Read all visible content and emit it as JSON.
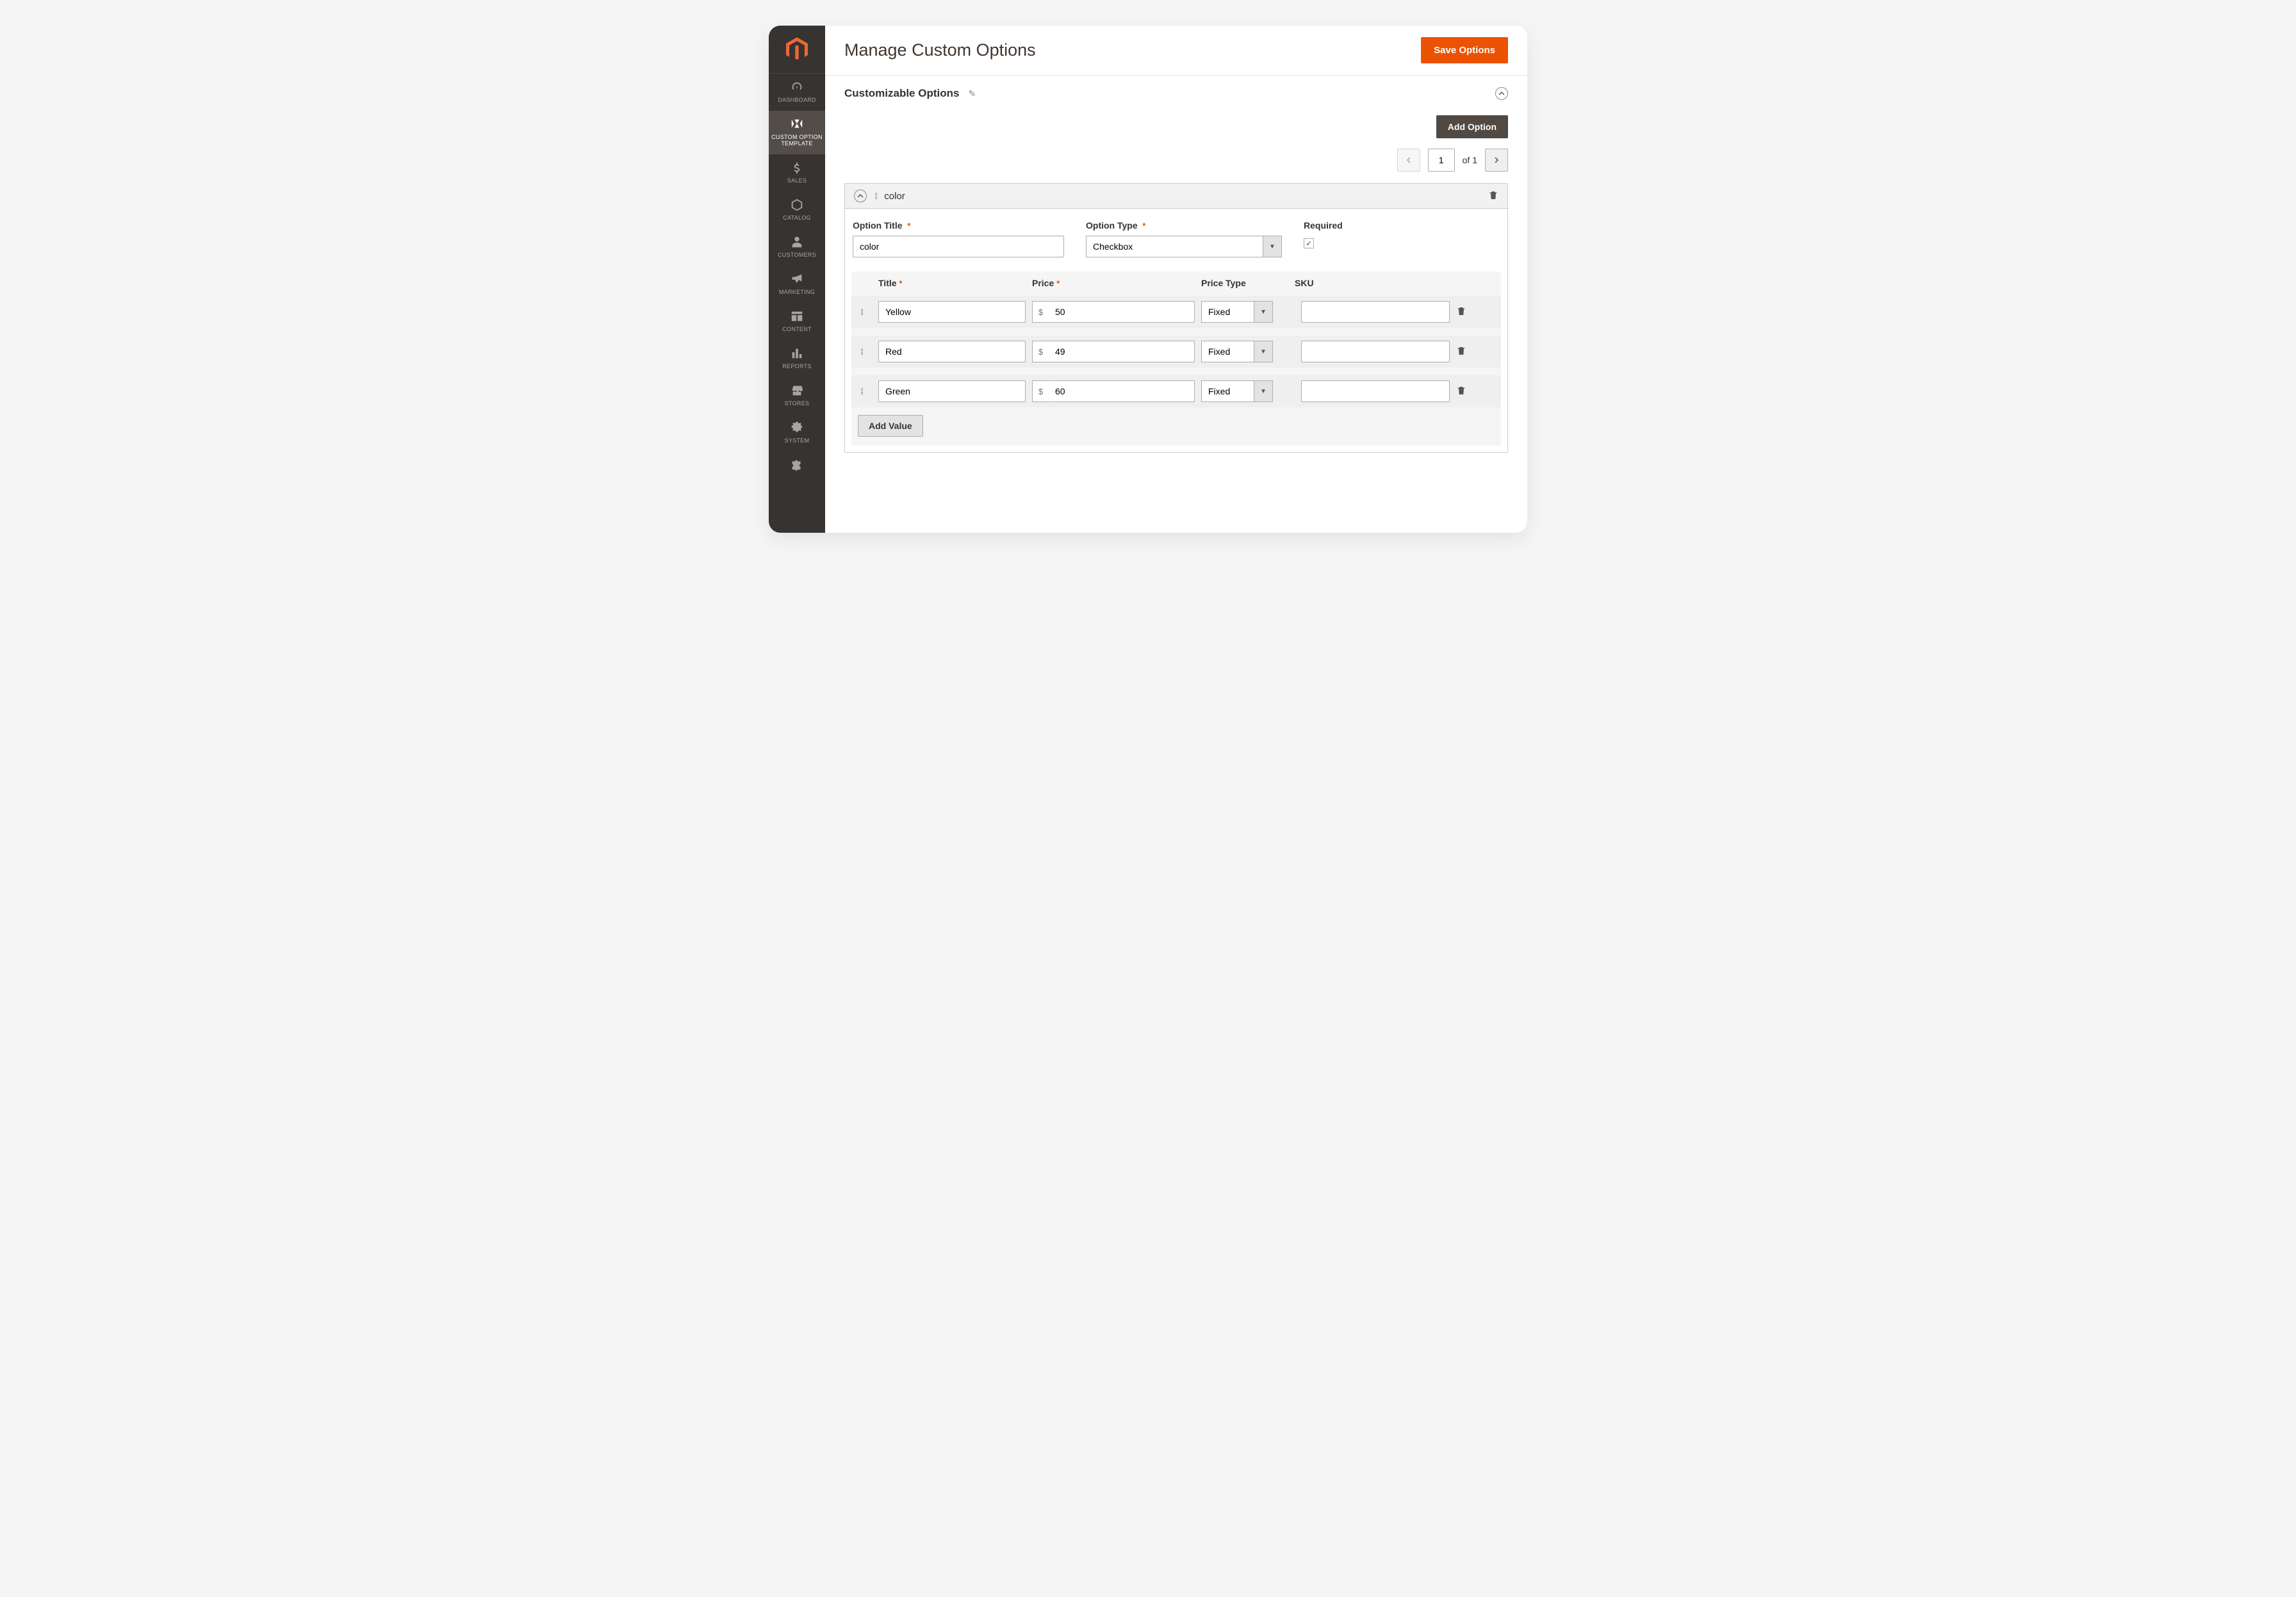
{
  "header": {
    "title": "Manage Custom Options",
    "save_button": "Save Options"
  },
  "section": {
    "title": "Customizable Options",
    "add_option": "Add Option"
  },
  "pager": {
    "page": "1",
    "of_label": "of 1"
  },
  "nav": {
    "dashboard": "DASHBOARD",
    "custom_option": "CUSTOM OPTION TEMPLATE",
    "sales": "SALES",
    "catalog": "CATALOG",
    "customers": "CUSTOMERS",
    "marketing": "MARKETING",
    "content": "CONTENT",
    "reports": "REPORTS",
    "stores": "STORES",
    "system": "SYSTEM"
  },
  "option": {
    "display_name": "color",
    "labels": {
      "option_title": "Option Title",
      "option_type": "Option Type",
      "required": "Required"
    },
    "title": "color",
    "type": "Checkbox",
    "required_checked": "✓"
  },
  "values_header": {
    "title": "Title",
    "price": "Price",
    "price_type": "Price Type",
    "sku": "SKU"
  },
  "values": {
    "currency": "$",
    "r0": {
      "title": "Yellow",
      "price": "50",
      "price_type": "Fixed",
      "sku": ""
    },
    "r1": {
      "title": "Red",
      "price": "49",
      "price_type": "Fixed",
      "sku": ""
    },
    "r2": {
      "title": "Green",
      "price": "60",
      "price_type": "Fixed",
      "sku": ""
    }
  },
  "add_value": "Add Value"
}
